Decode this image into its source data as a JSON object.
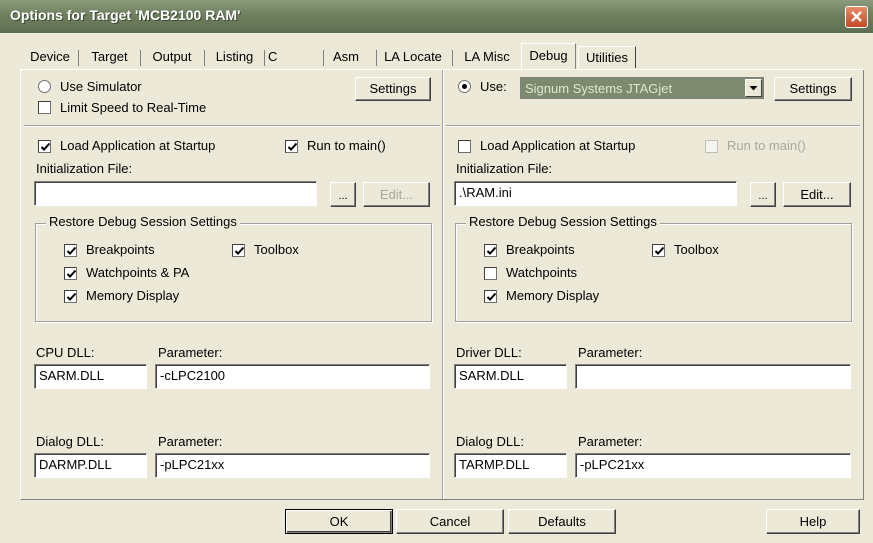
{
  "window": {
    "title": "Options for Target 'MCB2100 RAM'"
  },
  "tabs": [
    {
      "label": "Device"
    },
    {
      "label": "Target"
    },
    {
      "label": "Output"
    },
    {
      "label": "Listing"
    },
    {
      "label": "C"
    },
    {
      "label": "Asm"
    },
    {
      "label": "LA Locate"
    },
    {
      "label": "LA Misc"
    },
    {
      "label": "Debug"
    },
    {
      "label": "Utilities"
    }
  ],
  "active_tab": "Debug",
  "left": {
    "use_simulator": "Use Simulator",
    "use_simulator_selected": false,
    "limit_speed": "Limit Speed to Real-Time",
    "limit_speed_checked": false,
    "settings_label": "Settings",
    "load_app": "Load Application at Startup",
    "load_app_checked": true,
    "run_to_main": "Run to main()",
    "run_to_main_checked": true,
    "init_file_label": "Initialization File:",
    "init_file_value": "",
    "browse_label": "...",
    "edit_label": "Edit...",
    "restore_group": "Restore Debug Session Settings",
    "breakpoints": "Breakpoints",
    "toolbox": "Toolbox",
    "watchpoints": "Watchpoints & PA",
    "memory_display": "Memory Display",
    "dll1_label": "CPU DLL:",
    "dll1_value": "SARM.DLL",
    "param1_label": "Parameter:",
    "param1_value": "-cLPC2100",
    "dll2_label": "Dialog DLL:",
    "dll2_value": "DARMP.DLL",
    "param2_label": "Parameter:",
    "param2_value": "-pLPC21xx"
  },
  "right": {
    "use_label": "Use:",
    "use_selected": true,
    "driver_value": "Signum Systems JTAGjet",
    "settings_label": "Settings",
    "load_app": "Load Application at Startup",
    "load_app_checked": false,
    "run_to_main": "Run to main()",
    "run_to_main_enabled": false,
    "init_file_label": "Initialization File:",
    "init_file_value": ".\\RAM.ini",
    "browse_label": "...",
    "edit_label": "Edit...",
    "restore_group": "Restore Debug Session Settings",
    "breakpoints": "Breakpoints",
    "toolbox": "Toolbox",
    "watchpoints": "Watchpoints",
    "watchpoints_checked": false,
    "memory_display": "Memory Display",
    "dll1_label": "Driver DLL:",
    "dll1_value": "SARM.DLL",
    "param1_label": "Parameter:",
    "param1_value": "",
    "dll2_label": "Dialog DLL:",
    "dll2_value": "TARMP.DLL",
    "param2_label": "Parameter:",
    "param2_value": "-pLPC21xx"
  },
  "footer": {
    "ok": "OK",
    "cancel": "Cancel",
    "defaults": "Defaults",
    "help": "Help"
  },
  "colors": {
    "title_bar": "#6f8060",
    "dialog_bg": "#ece9d8",
    "combo_bg": "#7e8a6e",
    "close_button": "#c24a24"
  },
  "icons": {
    "checkmark": "check-icon",
    "close": "close-icon",
    "dropdown": "chevron-down-icon"
  }
}
